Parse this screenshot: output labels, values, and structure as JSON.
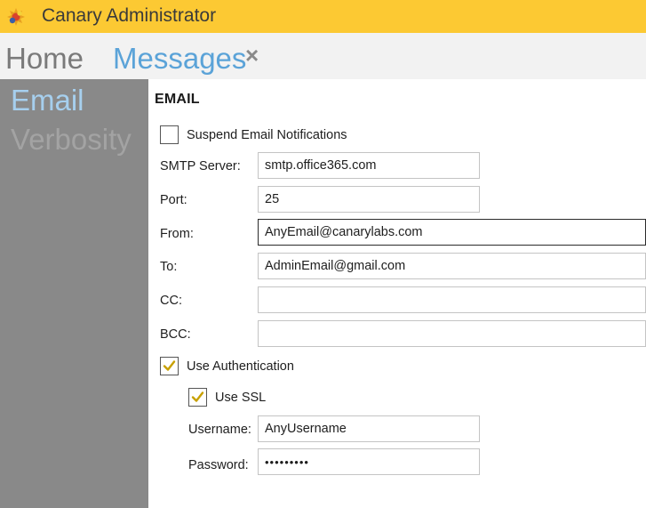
{
  "app": {
    "title": "Canary Administrator"
  },
  "tabs": {
    "home": "Home",
    "messages": "Messages",
    "close_glyph": "×"
  },
  "sidebar": {
    "items": [
      {
        "label": "Email"
      },
      {
        "label": "Verbosity"
      }
    ]
  },
  "email": {
    "section_title": "EMAIL",
    "suspend": {
      "label": "Suspend Email Notifications",
      "checked": false
    },
    "smtp": {
      "label": "SMTP Server:",
      "value": "smtp.office365.com"
    },
    "port": {
      "label": "Port:",
      "value": "25"
    },
    "from": {
      "label": "From:",
      "value": "AnyEmail@canarylabs.com"
    },
    "to": {
      "label": "To:",
      "value": "AdminEmail@gmail.com"
    },
    "cc": {
      "label": "CC:",
      "value": ""
    },
    "bcc": {
      "label": "BCC:",
      "value": ""
    },
    "use_auth": {
      "label": "Use Authentication",
      "checked": true
    },
    "use_ssl": {
      "label": "Use SSL",
      "checked": true
    },
    "username": {
      "label": "Username:",
      "value": "AnyUsername"
    },
    "password": {
      "label": "Password:",
      "value": "AnyPasswd"
    }
  },
  "colors": {
    "titlebar": "#fcc933",
    "accent": "#5ba3d8",
    "sidebar": "#898989",
    "check": "#c8a000"
  },
  "icons": {
    "app": "canary-logo-icon",
    "check": "checkmark-icon",
    "close": "close-icon"
  }
}
